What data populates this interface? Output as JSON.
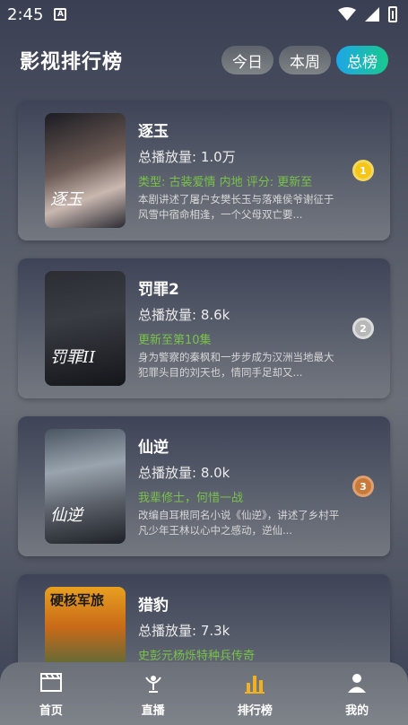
{
  "status": {
    "time": "2:45"
  },
  "header": {
    "title": "影视排行榜",
    "tabs": [
      {
        "label": "今日"
      },
      {
        "label": "本周"
      },
      {
        "label": "总榜"
      }
    ]
  },
  "items": [
    {
      "title": "逐玉",
      "plays": "总播放量: 1.0万",
      "tag": "类型: 古装爱情   内地   评分:   更新至",
      "desc": "本剧讲述了屠户女樊长玉与落难侯爷谢征于风雪中宿命相逢，一个父母双亡要...",
      "poster_text": "逐玉",
      "rank": "1"
    },
    {
      "title": "罚罪2",
      "plays": "总播放量: 8.6k",
      "tag": "更新至第10集",
      "desc": "身为警察的秦枫和一步步成为汉洲当地最大犯罪头目的刘天也，情同手足却又...",
      "poster_text": "罚罪II",
      "rank": "2"
    },
    {
      "title": "仙逆",
      "plays": "总播放量: 8.0k",
      "tag": "我辈修士，何惜一战",
      "desc": "改编自耳根同名小说《仙逆》，讲述了乡村平凡少年王林以心中之感动，逆仙...",
      "poster_text": "仙逆",
      "rank": "3"
    },
    {
      "title": "猎豹",
      "plays": "总播放量: 7.3k",
      "tag": "史彭元杨烁特种兵传奇",
      "desc": "",
      "poster_text": "硬核军旅",
      "rank": ""
    }
  ],
  "nav": [
    {
      "label": "首页"
    },
    {
      "label": "直播"
    },
    {
      "label": "排行榜"
    },
    {
      "label": "我的"
    }
  ],
  "colors": {
    "accent_start": "#1ea6e8",
    "accent_end": "#19c98d",
    "tag_green": "#79c24a",
    "nav_active": "#f0b020"
  }
}
